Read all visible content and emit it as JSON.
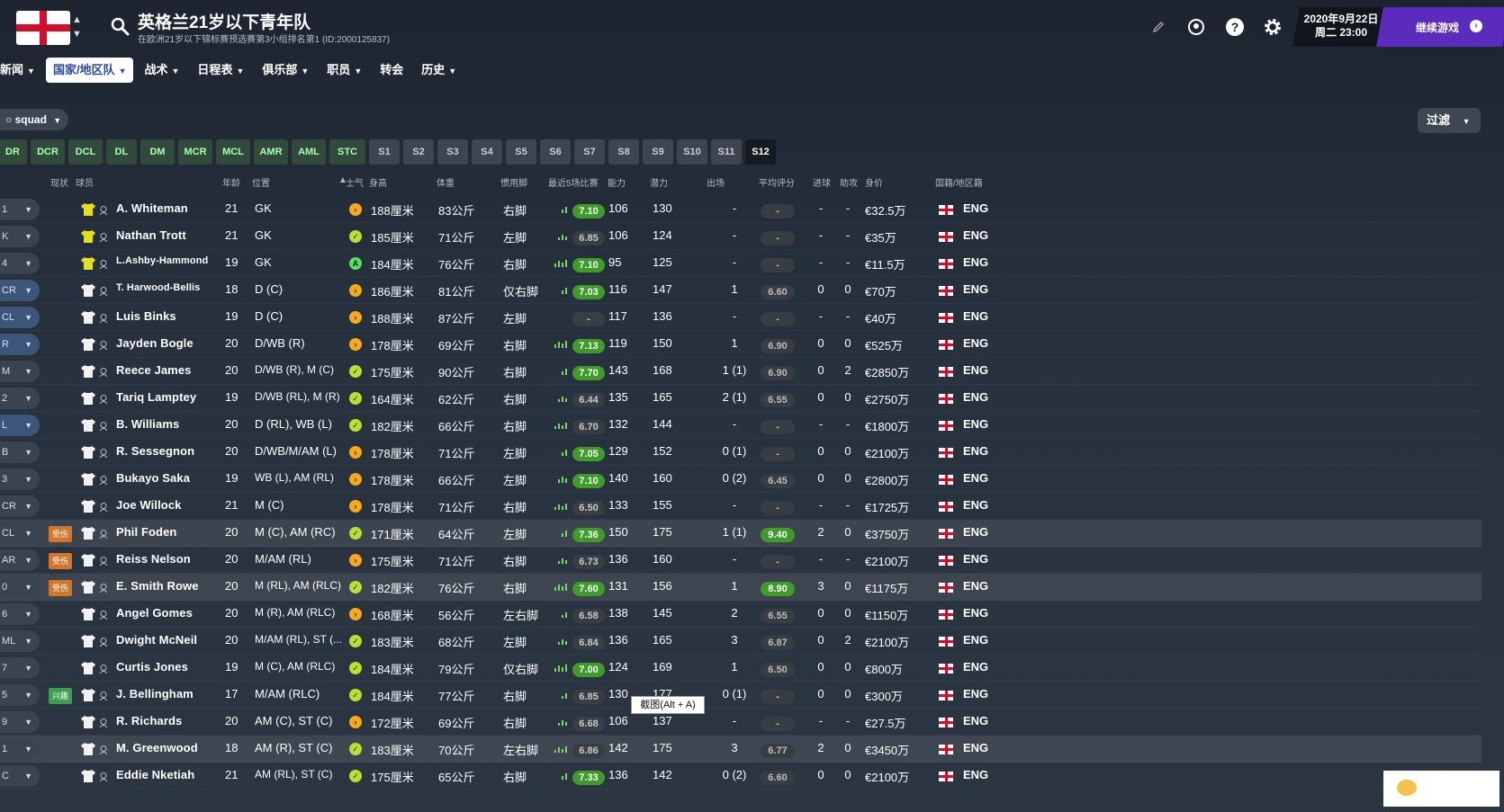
{
  "header": {
    "title": "英格兰21岁以下青年队",
    "subtitle": "在欧洲21岁以下锦标赛预选赛第3小组排名第1 (ID:2000125837)",
    "date_line1": "2020年9月22日",
    "date_line2": "周二 23:00",
    "continue_label": "继续游戏"
  },
  "nav": {
    "items": [
      {
        "label": "新闻"
      },
      {
        "label": "国家/地区队"
      },
      {
        "label": "战术"
      },
      {
        "label": "日程表"
      },
      {
        "label": "俱乐部"
      },
      {
        "label": "职员"
      },
      {
        "label": "转会"
      },
      {
        "label": "历史"
      }
    ]
  },
  "toolbar": {
    "squad_label": "squad",
    "filter_label": "过滤"
  },
  "tabs": [
    "DR",
    "DCR",
    "DCL",
    "DL",
    "DM",
    "MCR",
    "MCL",
    "AMR",
    "AML",
    "STC",
    "S1",
    "S2",
    "S3",
    "S4",
    "S5",
    "S6",
    "S7",
    "S8",
    "S9",
    "S10",
    "S11",
    "S12"
  ],
  "columns": {
    "status": "现状",
    "player": "球员",
    "age": "年龄",
    "position": "位置",
    "morale": "士气",
    "height": "身高",
    "weight": "体重",
    "foot": "惯用脚",
    "form": "最近5场比赛",
    "ca": "能力",
    "pa": "潜力",
    "apps": "出场",
    "rating": "平均评分",
    "goals": "进球",
    "assists": "助攻",
    "value": "身价",
    "nation": "国籍/地区籍"
  },
  "players": [
    {
      "role": "1",
      "badge": "",
      "kit": "gk",
      "name": "A. Whiteman",
      "age": "21",
      "pos": "GK",
      "morale": "o",
      "height": "188厘米",
      "weight": "83公斤",
      "foot": "右脚",
      "form": "7.10",
      "form_style": "gr",
      "ca": "106",
      "pa": "130",
      "apps": "-",
      "rating": "-",
      "rating_style": "dk",
      "goals": "-",
      "assists": "-",
      "value": "€32.5万",
      "nat": "ENG"
    },
    {
      "role": "K",
      "badge": "",
      "kit": "gk",
      "name": "Nathan Trott",
      "age": "21",
      "pos": "GK",
      "morale": "g",
      "height": "185厘米",
      "weight": "71公斤",
      "foot": "左脚",
      "form": "6.85",
      "form_style": "dk",
      "ca": "106",
      "pa": "124",
      "apps": "-",
      "rating": "-",
      "rating_style": "dk",
      "goals": "-",
      "assists": "-",
      "value": "€35万",
      "nat": "ENG"
    },
    {
      "role": "4",
      "badge": "",
      "kit": "gk",
      "name": "L.Ashby-Hammond",
      "age": "19",
      "pos": "GK",
      "morale": "a",
      "height": "184厘米",
      "weight": "76公斤",
      "foot": "右脚",
      "form": "7.10",
      "form_style": "gr",
      "ca": "95",
      "pa": "125",
      "apps": "-",
      "rating": "-",
      "rating_style": "dk",
      "goals": "-",
      "assists": "-",
      "value": "€11.5万",
      "nat": "ENG"
    },
    {
      "role": "CR",
      "badge": "",
      "kit": "w",
      "name": "T. Harwood-Bellis",
      "age": "18",
      "pos": "D (C)",
      "morale": "o",
      "height": "186厘米",
      "weight": "81公斤",
      "foot": "仅右脚",
      "form": "7.03",
      "form_style": "gr",
      "ca": "116",
      "pa": "147",
      "apps": "1",
      "rating": "6.60",
      "rating_style": "dk",
      "goals": "0",
      "assists": "0",
      "value": "€70万",
      "nat": "ENG"
    },
    {
      "role": "CL",
      "badge": "",
      "kit": "w",
      "name": "Luis Binks",
      "age": "19",
      "pos": "D (C)",
      "morale": "o",
      "height": "188厘米",
      "weight": "87公斤",
      "foot": "左脚",
      "form": "-",
      "form_style": "dk",
      "ca": "117",
      "pa": "136",
      "apps": "-",
      "rating": "-",
      "rating_style": "dk",
      "goals": "-",
      "assists": "-",
      "value": "€40万",
      "nat": "ENG"
    },
    {
      "role": "R",
      "badge": "",
      "kit": "w",
      "name": "Jayden Bogle",
      "age": "20",
      "pos": "D/WB (R)",
      "morale": "o",
      "height": "178厘米",
      "weight": "69公斤",
      "foot": "右脚",
      "form": "7.13",
      "form_style": "gr",
      "ca": "119",
      "pa": "150",
      "apps": "1",
      "rating": "6.90",
      "rating_style": "dk",
      "goals": "0",
      "assists": "0",
      "value": "€525万",
      "nat": "ENG"
    },
    {
      "role": "M",
      "badge": "",
      "kit": "w",
      "name": "Reece James",
      "age": "20",
      "pos": "D/WB (R), M (C)",
      "morale": "g",
      "height": "175厘米",
      "weight": "90公斤",
      "foot": "右脚",
      "form": "7.70",
      "form_style": "gr",
      "ca": "143",
      "pa": "168",
      "apps": "1 (1)",
      "rating": "6.90",
      "rating_style": "dk",
      "goals": "0",
      "assists": "2",
      "value": "€2850万",
      "nat": "ENG"
    },
    {
      "role": "2",
      "badge": "",
      "kit": "w",
      "name": "Tariq Lamptey",
      "age": "19",
      "pos": "D/WB (RL), M (R)",
      "morale": "g",
      "height": "164厘米",
      "weight": "62公斤",
      "foot": "右脚",
      "form": "6.44",
      "form_style": "dk",
      "ca": "135",
      "pa": "165",
      "apps": "2 (1)",
      "rating": "6.55",
      "rating_style": "dk",
      "goals": "0",
      "assists": "0",
      "value": "€2750万",
      "nat": "ENG"
    },
    {
      "role": "L",
      "badge": "",
      "kit": "w",
      "name": "B. Williams",
      "age": "20",
      "pos": "D (RL), WB (L)",
      "morale": "g",
      "height": "182厘米",
      "weight": "66公斤",
      "foot": "右脚",
      "form": "6.70",
      "form_style": "dk",
      "ca": "132",
      "pa": "144",
      "apps": "-",
      "rating": "-",
      "rating_style": "dk",
      "goals": "-",
      "assists": "-",
      "value": "€1800万",
      "nat": "ENG"
    },
    {
      "role": "B",
      "badge": "",
      "kit": "w",
      "name": "R. Sessegnon",
      "age": "20",
      "pos": "D/WB/M/AM (L)",
      "morale": "o",
      "height": "178厘米",
      "weight": "71公斤",
      "foot": "左脚",
      "form": "7.05",
      "form_style": "gr",
      "ca": "129",
      "pa": "152",
      "apps": "0 (1)",
      "rating": "-",
      "rating_style": "dk",
      "goals": "0",
      "assists": "0",
      "value": "€2100万",
      "nat": "ENG"
    },
    {
      "role": "3",
      "badge": "",
      "kit": "w",
      "name": "Bukayo Saka",
      "age": "19",
      "pos": "WB (L), AM (RL)",
      "morale": "o",
      "height": "178厘米",
      "weight": "66公斤",
      "foot": "左脚",
      "form": "7.10",
      "form_style": "gr",
      "ca": "140",
      "pa": "160",
      "apps": "0 (2)",
      "rating": "6.45",
      "rating_style": "dk",
      "goals": "0",
      "assists": "0",
      "value": "€2800万",
      "nat": "ENG"
    },
    {
      "role": "CR",
      "badge": "",
      "kit": "w",
      "name": "Joe Willock",
      "age": "21",
      "pos": "M (C)",
      "morale": "o",
      "height": "178厘米",
      "weight": "71公斤",
      "foot": "右脚",
      "form": "6.50",
      "form_style": "dk",
      "ca": "133",
      "pa": "155",
      "apps": "-",
      "rating": "-",
      "rating_style": "dk",
      "goals": "-",
      "assists": "-",
      "value": "€1725万",
      "nat": "ENG"
    },
    {
      "role": "CL",
      "badge": "受伤",
      "kit": "w",
      "name": "Phil Foden",
      "age": "20",
      "pos": "M (C), AM (RC)",
      "morale": "g",
      "height": "171厘米",
      "weight": "64公斤",
      "foot": "左脚",
      "form": "7.36",
      "form_style": "gr",
      "ca": "150",
      "pa": "175",
      "apps": "1 (1)",
      "rating": "9.40",
      "rating_style": "gr",
      "goals": "2",
      "assists": "0",
      "value": "€3750万",
      "nat": "ENG"
    },
    {
      "role": "AR",
      "badge": "受伤",
      "kit": "w",
      "name": "Reiss Nelson",
      "age": "20",
      "pos": "M/AM (RL)",
      "morale": "o",
      "height": "175厘米",
      "weight": "71公斤",
      "foot": "右脚",
      "form": "6.73",
      "form_style": "dk",
      "ca": "136",
      "pa": "160",
      "apps": "-",
      "rating": "-",
      "rating_style": "dk",
      "goals": "-",
      "assists": "-",
      "value": "€2100万",
      "nat": "ENG"
    },
    {
      "role": "0",
      "badge": "受伤",
      "kit": "w",
      "name": "E. Smith Rowe",
      "age": "20",
      "pos": "M (RL), AM (RLC)",
      "morale": "g",
      "height": "182厘米",
      "weight": "76公斤",
      "foot": "右脚",
      "form": "7.60",
      "form_style": "gr",
      "ca": "131",
      "pa": "156",
      "apps": "1",
      "rating": "8.90",
      "rating_style": "gr",
      "goals": "3",
      "assists": "0",
      "value": "€1175万",
      "nat": "ENG"
    },
    {
      "role": "6",
      "badge": "",
      "kit": "w",
      "name": "Angel Gomes",
      "age": "20",
      "pos": "M (R), AM (RLC)",
      "morale": "o",
      "height": "168厘米",
      "weight": "56公斤",
      "foot": "左右脚",
      "form": "6.58",
      "form_style": "dk",
      "ca": "138",
      "pa": "145",
      "apps": "2",
      "rating": "6.55",
      "rating_style": "dk",
      "goals": "0",
      "assists": "0",
      "value": "€1150万",
      "nat": "ENG"
    },
    {
      "role": "ML",
      "badge": "",
      "kit": "w",
      "name": "Dwight McNeil",
      "age": "20",
      "pos": "M/AM (RL), ST (...",
      "morale": "g",
      "height": "183厘米",
      "weight": "68公斤",
      "foot": "左脚",
      "form": "6.84",
      "form_style": "dk",
      "ca": "136",
      "pa": "165",
      "apps": "3",
      "rating": "6.87",
      "rating_style": "dk",
      "goals": "0",
      "assists": "2",
      "value": "€2100万",
      "nat": "ENG"
    },
    {
      "role": "7",
      "badge": "",
      "kit": "w",
      "name": "Curtis Jones",
      "age": "19",
      "pos": "M (C), AM (RLC)",
      "morale": "g",
      "height": "184厘米",
      "weight": "79公斤",
      "foot": "仅右脚",
      "form": "7.00",
      "form_style": "gr",
      "ca": "124",
      "pa": "169",
      "apps": "1",
      "rating": "6.50",
      "rating_style": "dk",
      "goals": "0",
      "assists": "0",
      "value": "€800万",
      "nat": "ENG"
    },
    {
      "role": "5",
      "badge": "兴趣",
      "kit": "w",
      "name": "J. Bellingham",
      "age": "17",
      "pos": "M/AM (RLC)",
      "morale": "g",
      "height": "184厘米",
      "weight": "77公斤",
      "foot": "右脚",
      "form": "6.85",
      "form_style": "dk",
      "ca": "130",
      "pa": "177",
      "apps": "0 (1)",
      "rating": "-",
      "rating_style": "dk",
      "goals": "0",
      "assists": "0",
      "value": "€300万",
      "nat": "ENG"
    },
    {
      "role": "9",
      "badge": "",
      "kit": "w",
      "name": "R. Richards",
      "age": "20",
      "pos": "AM (C), ST (C)",
      "morale": "o",
      "height": "172厘米",
      "weight": "69公斤",
      "foot": "右脚",
      "form": "6.68",
      "form_style": "dk",
      "ca": "106",
      "pa": "137",
      "apps": "-",
      "rating": "-",
      "rating_style": "dk",
      "goals": "-",
      "assists": "-",
      "value": "€27.5万",
      "nat": "ENG"
    },
    {
      "role": "1",
      "badge": "",
      "kit": "w",
      "name": "M. Greenwood",
      "age": "18",
      "pos": "AM (R), ST (C)",
      "morale": "g",
      "height": "183厘米",
      "weight": "70公斤",
      "foot": "左右脚",
      "form": "6.86",
      "form_style": "dk",
      "ca": "142",
      "pa": "175",
      "apps": "3",
      "rating": "6.77",
      "rating_style": "dk",
      "goals": "2",
      "assists": "0",
      "value": "€3450万",
      "nat": "ENG"
    },
    {
      "role": "C",
      "badge": "",
      "kit": "w",
      "name": "Eddie Nketiah",
      "age": "21",
      "pos": "AM (RL), ST (C)",
      "morale": "g",
      "height": "175厘米",
      "weight": "65公斤",
      "foot": "右脚",
      "form": "7.33",
      "form_style": "gr",
      "ca": "136",
      "pa": "142",
      "apps": "0 (2)",
      "rating": "6.60",
      "rating_style": "dk",
      "goals": "0",
      "assists": "0",
      "value": "€2100万",
      "nat": "ENG"
    }
  ],
  "tooltip": "截图(Alt + A)"
}
